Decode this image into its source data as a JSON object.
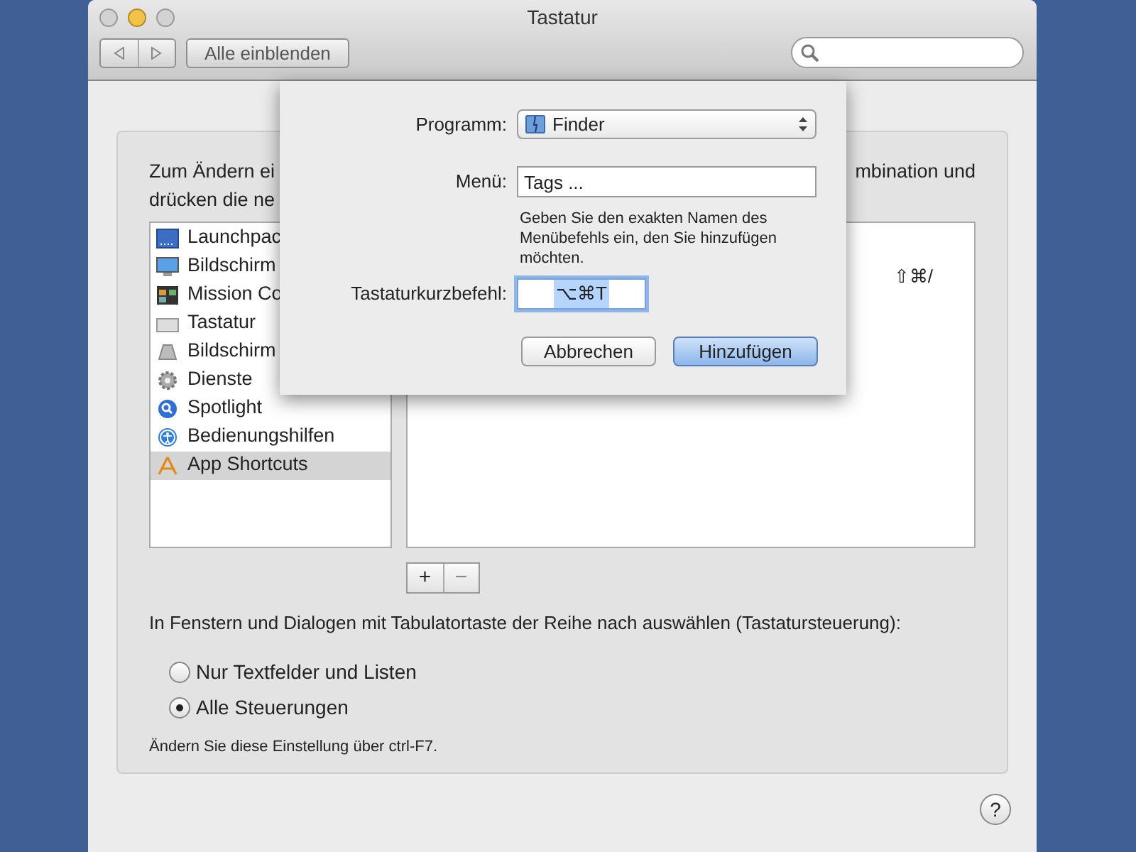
{
  "window": {
    "title": "Tastatur",
    "show_all_button": "Alle einblenden"
  },
  "panel": {
    "intro_fragments": [
      "Zum Ändern ei",
      "mbination und",
      "drücken die ne"
    ],
    "categories": [
      {
        "label": "Launchpac",
        "selected": false
      },
      {
        "label": "Bildschirm",
        "selected": false
      },
      {
        "label": "Mission Co",
        "selected": false
      },
      {
        "label": "Tastatur",
        "selected": false
      },
      {
        "label": "Bildschirm",
        "selected": false
      },
      {
        "label": "Dienste",
        "selected": false
      },
      {
        "label": "Spotlight",
        "selected": false
      },
      {
        "label": "Bedienungshilfen",
        "selected": false
      },
      {
        "label": "App Shortcuts",
        "selected": true
      }
    ],
    "shortcut_visible": "⇧⌘/",
    "add_button": "+",
    "remove_button": "−",
    "keyboard_access": {
      "label": "In Fenstern und Dialogen mit Tabulatortaste der Reihe nach auswählen (Tastatursteuerung):",
      "options": [
        {
          "label": "Nur Textfelder und Listen",
          "selected": false
        },
        {
          "label": "Alle Steuerungen",
          "selected": true
        }
      ],
      "note": "Ändern Sie diese Einstellung über ctrl-F7."
    }
  },
  "help_button": "?",
  "sheet": {
    "program_label": "Programm:",
    "program_value": "Finder",
    "menu_label": "Menü:",
    "menu_value": "Tags ...",
    "hint": "Geben Sie den exakten Namen des Menübefehls ein, den Sie hinzufügen möchten.",
    "shortcut_label": "Tastaturkurzbefehl:",
    "shortcut_value": "⌥⌘T",
    "buttons": [
      {
        "label": "Abbrechen",
        "default": false
      },
      {
        "label": "Hinzufügen",
        "default": true
      }
    ]
  }
}
